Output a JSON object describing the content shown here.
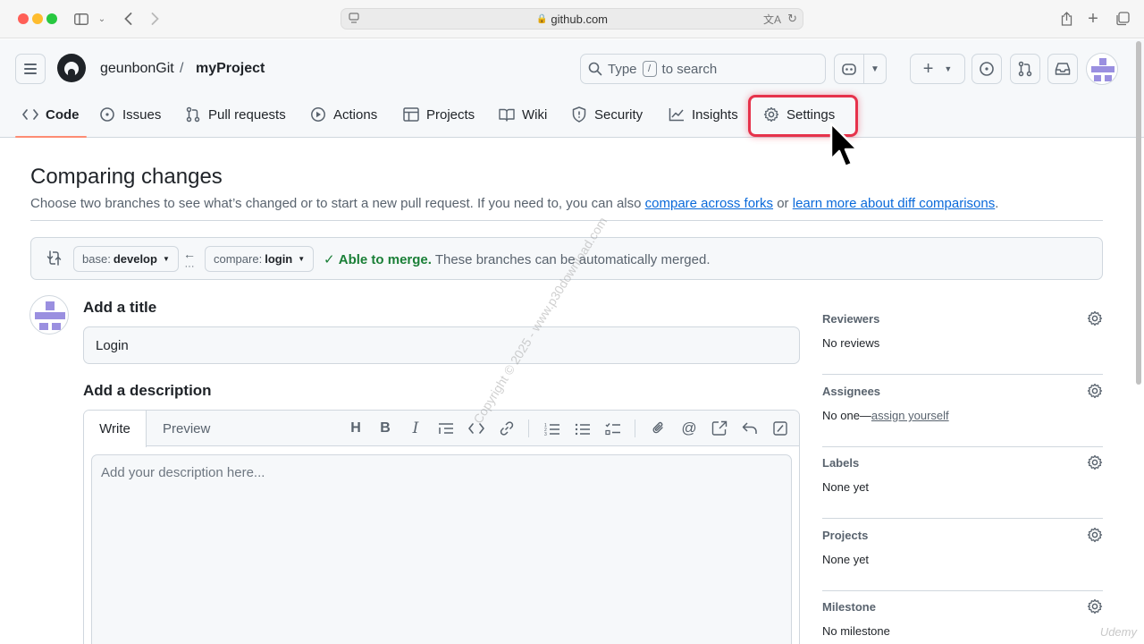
{
  "browser": {
    "url": "github.com"
  },
  "header": {
    "owner": "geunbonGit",
    "separator": "/",
    "repo": "myProject",
    "search_prefix": "Type",
    "search_key": "/",
    "search_suffix": "to search"
  },
  "tabs": [
    {
      "label": "Code",
      "icon": "code-icon"
    },
    {
      "label": "Issues",
      "icon": "issue-icon"
    },
    {
      "label": "Pull requests",
      "icon": "pull-request-icon"
    },
    {
      "label": "Actions",
      "icon": "play-icon"
    },
    {
      "label": "Projects",
      "icon": "table-icon"
    },
    {
      "label": "Wiki",
      "icon": "book-icon"
    },
    {
      "label": "Security",
      "icon": "shield-icon"
    },
    {
      "label": "Insights",
      "icon": "graph-icon"
    },
    {
      "label": "Settings",
      "icon": "gear-icon"
    }
  ],
  "main": {
    "title": "Comparing changes",
    "desc_start": "Choose two branches to see what’s changed or to start a new pull request. If you need to, you can also ",
    "link_forks": "compare across forks",
    "desc_or": " or ",
    "link_learn": "learn more about diff comparisons",
    "desc_end": "."
  },
  "compare": {
    "base_prefix": "base:",
    "base_branch": "develop",
    "compare_prefix": "compare:",
    "compare_branch": "login",
    "merge_ok": "Able to merge.",
    "merge_text": " These branches can be automatically merged."
  },
  "form": {
    "title_label": "Add a title",
    "title_value": "Login",
    "desc_label": "Add a description",
    "write_tab": "Write",
    "preview_tab": "Preview",
    "desc_placeholder": "Add your description here..."
  },
  "sidebar": {
    "reviewers": {
      "heading": "Reviewers",
      "value": "No reviews"
    },
    "assignees": {
      "heading": "Assignees",
      "value": "No one—",
      "link": "assign yourself"
    },
    "labels": {
      "heading": "Labels",
      "value": "None yet"
    },
    "projects": {
      "heading": "Projects",
      "value": "None yet"
    },
    "milestone": {
      "heading": "Milestone",
      "value": "No milestone"
    }
  },
  "overlay": {
    "watermark": "Copyright © 2025 - www.p30download.com",
    "udemy": "Udemy"
  },
  "colors": {
    "accent_link": "#0969da",
    "merge_green": "#1a7f37",
    "tab_underline": "#fd8c73",
    "highlight_red": "#e6324b"
  }
}
